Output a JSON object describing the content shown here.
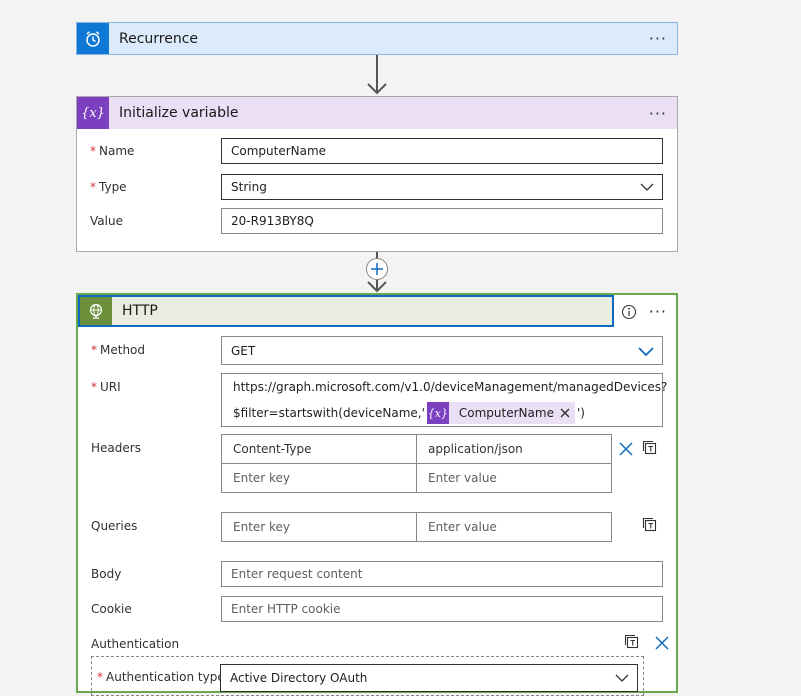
{
  "recurrence": {
    "title": "Recurrence",
    "more": "···"
  },
  "init_variable": {
    "title": "Initialize variable",
    "icon_text": "{x}",
    "more": "···",
    "name_label": "Name",
    "name_value": "ComputerName",
    "type_label": "Type",
    "type_value": "String",
    "value_label": "Value",
    "value_value": "20-R913BY8Q"
  },
  "http": {
    "title": "HTTP",
    "more": "···",
    "method_label": "Method",
    "method_value": "GET",
    "uri_label": "URI",
    "uri_line1": "https://graph.microsoft.com/v1.0/deviceManagement/managedDevices?",
    "uri_line2_prefix": "$filter=startswith(deviceName,'",
    "uri_token": "ComputerName",
    "uri_token_icon": "{x}",
    "uri_line2_suffix": "')",
    "headers_label": "Headers",
    "headers_key": "Content-Type",
    "headers_value": "application/json",
    "key_placeholder": "Enter key",
    "value_placeholder": "Enter value",
    "queries_label": "Queries",
    "body_label": "Body",
    "body_placeholder": "Enter request content",
    "cookie_label": "Cookie",
    "cookie_placeholder": "Enter HTTP cookie",
    "auth_label": "Authentication",
    "auth_type_label": "Authentication type",
    "auth_type_value": "Active Directory OAuth"
  },
  "colors": {
    "recurrence_tile": "#0f78d4",
    "variable_tile": "#7b3fbf",
    "http_tile": "#6b8f3b",
    "http_border": "#6aa84f",
    "focus_border": "#0f6cbd"
  }
}
